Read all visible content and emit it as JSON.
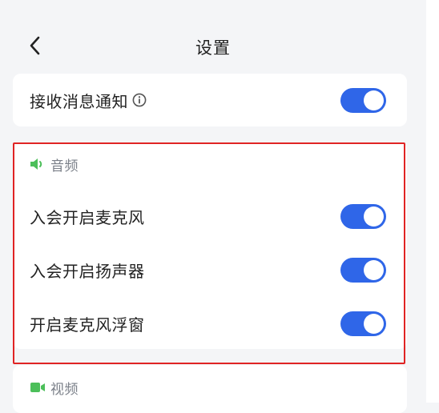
{
  "header": {
    "title": "设置"
  },
  "notify": {
    "label": "接收消息通知",
    "enabled": true
  },
  "audio": {
    "section_label": "音频",
    "items": [
      {
        "label": "入会开启麦克风",
        "enabled": true
      },
      {
        "label": "入会开启扬声器",
        "enabled": true
      },
      {
        "label": "开启麦克风浮窗",
        "enabled": true
      }
    ]
  },
  "video": {
    "section_label": "视频"
  },
  "icons": {
    "back": "chevron-left-icon",
    "info": "info-icon",
    "audio": "speaker-icon",
    "video": "camera-icon"
  },
  "colors": {
    "toggle_on": "#2f66e8",
    "section_icon": "#4cbf5a",
    "highlight": "#e02424"
  }
}
